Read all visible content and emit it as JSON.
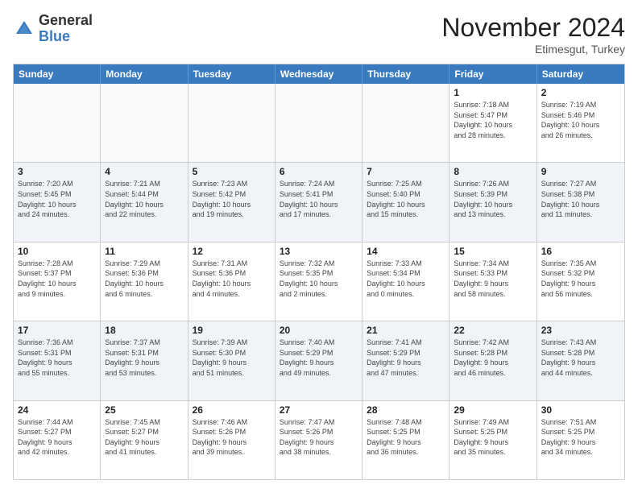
{
  "logo": {
    "general": "General",
    "blue": "Blue"
  },
  "header": {
    "month": "November 2024",
    "location": "Etimesgut, Turkey"
  },
  "weekdays": [
    "Sunday",
    "Monday",
    "Tuesday",
    "Wednesday",
    "Thursday",
    "Friday",
    "Saturday"
  ],
  "rows": [
    [
      {
        "day": "",
        "info": ""
      },
      {
        "day": "",
        "info": ""
      },
      {
        "day": "",
        "info": ""
      },
      {
        "day": "",
        "info": ""
      },
      {
        "day": "",
        "info": ""
      },
      {
        "day": "1",
        "info": "Sunrise: 7:18 AM\nSunset: 5:47 PM\nDaylight: 10 hours\nand 28 minutes."
      },
      {
        "day": "2",
        "info": "Sunrise: 7:19 AM\nSunset: 5:46 PM\nDaylight: 10 hours\nand 26 minutes."
      }
    ],
    [
      {
        "day": "3",
        "info": "Sunrise: 7:20 AM\nSunset: 5:45 PM\nDaylight: 10 hours\nand 24 minutes."
      },
      {
        "day": "4",
        "info": "Sunrise: 7:21 AM\nSunset: 5:44 PM\nDaylight: 10 hours\nand 22 minutes."
      },
      {
        "day": "5",
        "info": "Sunrise: 7:23 AM\nSunset: 5:42 PM\nDaylight: 10 hours\nand 19 minutes."
      },
      {
        "day": "6",
        "info": "Sunrise: 7:24 AM\nSunset: 5:41 PM\nDaylight: 10 hours\nand 17 minutes."
      },
      {
        "day": "7",
        "info": "Sunrise: 7:25 AM\nSunset: 5:40 PM\nDaylight: 10 hours\nand 15 minutes."
      },
      {
        "day": "8",
        "info": "Sunrise: 7:26 AM\nSunset: 5:39 PM\nDaylight: 10 hours\nand 13 minutes."
      },
      {
        "day": "9",
        "info": "Sunrise: 7:27 AM\nSunset: 5:38 PM\nDaylight: 10 hours\nand 11 minutes."
      }
    ],
    [
      {
        "day": "10",
        "info": "Sunrise: 7:28 AM\nSunset: 5:37 PM\nDaylight: 10 hours\nand 9 minutes."
      },
      {
        "day": "11",
        "info": "Sunrise: 7:29 AM\nSunset: 5:36 PM\nDaylight: 10 hours\nand 6 minutes."
      },
      {
        "day": "12",
        "info": "Sunrise: 7:31 AM\nSunset: 5:36 PM\nDaylight: 10 hours\nand 4 minutes."
      },
      {
        "day": "13",
        "info": "Sunrise: 7:32 AM\nSunset: 5:35 PM\nDaylight: 10 hours\nand 2 minutes."
      },
      {
        "day": "14",
        "info": "Sunrise: 7:33 AM\nSunset: 5:34 PM\nDaylight: 10 hours\nand 0 minutes."
      },
      {
        "day": "15",
        "info": "Sunrise: 7:34 AM\nSunset: 5:33 PM\nDaylight: 9 hours\nand 58 minutes."
      },
      {
        "day": "16",
        "info": "Sunrise: 7:35 AM\nSunset: 5:32 PM\nDaylight: 9 hours\nand 56 minutes."
      }
    ],
    [
      {
        "day": "17",
        "info": "Sunrise: 7:36 AM\nSunset: 5:31 PM\nDaylight: 9 hours\nand 55 minutes."
      },
      {
        "day": "18",
        "info": "Sunrise: 7:37 AM\nSunset: 5:31 PM\nDaylight: 9 hours\nand 53 minutes."
      },
      {
        "day": "19",
        "info": "Sunrise: 7:39 AM\nSunset: 5:30 PM\nDaylight: 9 hours\nand 51 minutes."
      },
      {
        "day": "20",
        "info": "Sunrise: 7:40 AM\nSunset: 5:29 PM\nDaylight: 9 hours\nand 49 minutes."
      },
      {
        "day": "21",
        "info": "Sunrise: 7:41 AM\nSunset: 5:29 PM\nDaylight: 9 hours\nand 47 minutes."
      },
      {
        "day": "22",
        "info": "Sunrise: 7:42 AM\nSunset: 5:28 PM\nDaylight: 9 hours\nand 46 minutes."
      },
      {
        "day": "23",
        "info": "Sunrise: 7:43 AM\nSunset: 5:28 PM\nDaylight: 9 hours\nand 44 minutes."
      }
    ],
    [
      {
        "day": "24",
        "info": "Sunrise: 7:44 AM\nSunset: 5:27 PM\nDaylight: 9 hours\nand 42 minutes."
      },
      {
        "day": "25",
        "info": "Sunrise: 7:45 AM\nSunset: 5:27 PM\nDaylight: 9 hours\nand 41 minutes."
      },
      {
        "day": "26",
        "info": "Sunrise: 7:46 AM\nSunset: 5:26 PM\nDaylight: 9 hours\nand 39 minutes."
      },
      {
        "day": "27",
        "info": "Sunrise: 7:47 AM\nSunset: 5:26 PM\nDaylight: 9 hours\nand 38 minutes."
      },
      {
        "day": "28",
        "info": "Sunrise: 7:48 AM\nSunset: 5:25 PM\nDaylight: 9 hours\nand 36 minutes."
      },
      {
        "day": "29",
        "info": "Sunrise: 7:49 AM\nSunset: 5:25 PM\nDaylight: 9 hours\nand 35 minutes."
      },
      {
        "day": "30",
        "info": "Sunrise: 7:51 AM\nSunset: 5:25 PM\nDaylight: 9 hours\nand 34 minutes."
      }
    ]
  ]
}
